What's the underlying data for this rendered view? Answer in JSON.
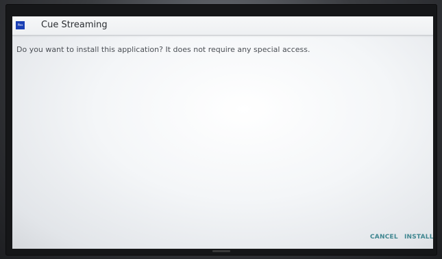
{
  "dialog": {
    "app_icon_text": "Plex",
    "title": "Cue Streaming",
    "message": "Do you want to install this application? It does not require any special access.",
    "buttons": {
      "cancel": "CANCEL",
      "install": "INSTALL"
    }
  },
  "colors": {
    "accent": "#3f8690",
    "app_icon_bg": "#1a3fb4",
    "title_text": "#2a2d31",
    "body_text": "#4a4e54"
  }
}
